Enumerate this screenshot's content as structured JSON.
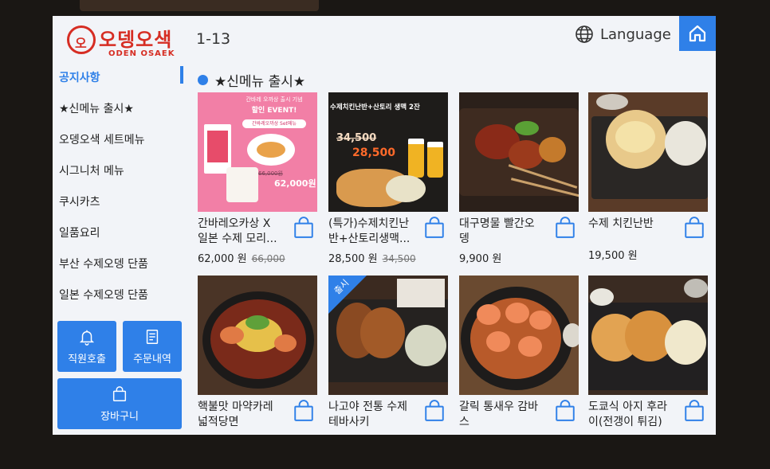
{
  "brand": {
    "name": "오뎅오색",
    "sub": "ODEN OSAEK",
    "mark": "오"
  },
  "header": {
    "table_no": "1-13",
    "language_label": "Language"
  },
  "sidebar": {
    "items": [
      {
        "label": "공지사항"
      },
      {
        "label": "★신메뉴 출시★"
      },
      {
        "label": "오뎅오색 세트메뉴"
      },
      {
        "label": "시그니처 메뉴"
      },
      {
        "label": "쿠시카츠"
      },
      {
        "label": "일품요리"
      },
      {
        "label": "부산 수제오뎅 단품"
      },
      {
        "label": "일본 수제오뎅 단품"
      }
    ],
    "staff_call": "직원호출",
    "order_history": "주문내역",
    "cart": "장바구니"
  },
  "main": {
    "section_title": "★신메뉴 출시★",
    "items": [
      {
        "name": "간바레오카상 X\n일본 수제 모리...",
        "price": "62,000 원",
        "old_price": "66,000",
        "poster": {
          "line1": "간바레 오까상 출시 기념",
          "line2": "할인 EVENT!",
          "line3": "간바레오까상 Set메뉴",
          "old": "66,000원",
          "new": "62,000원"
        }
      },
      {
        "name": "(특가)수제치킨난\n반+산토리생맥...",
        "price": "28,500 원",
        "old_price": "34,500",
        "poster": {
          "title": "수제치킨난반+산토리 생맥 2잔",
          "old": "34,500",
          "new": "28,500"
        }
      },
      {
        "name": "대구명물 빨간오\n뎅",
        "price": "9,900 원",
        "old_price": ""
      },
      {
        "name": "수제 치킨난반",
        "price": "19,500 원",
        "old_price": ""
      },
      {
        "name": "핵불맛 마약카레\n넓적당면",
        "price": "",
        "old_price": ""
      },
      {
        "name": "나고야 전통 수제\n테바사키",
        "price": "",
        "old_price": "",
        "badge": "출시"
      },
      {
        "name": "갈릭 통새우 감바\n스",
        "price": "",
        "old_price": ""
      },
      {
        "name": "도쿄식 아지 후라\n이(전갱이 튀김)",
        "price": "",
        "old_price": ""
      }
    ]
  },
  "colors": {
    "accent": "#2f80e8",
    "brand": "#d62d23"
  }
}
